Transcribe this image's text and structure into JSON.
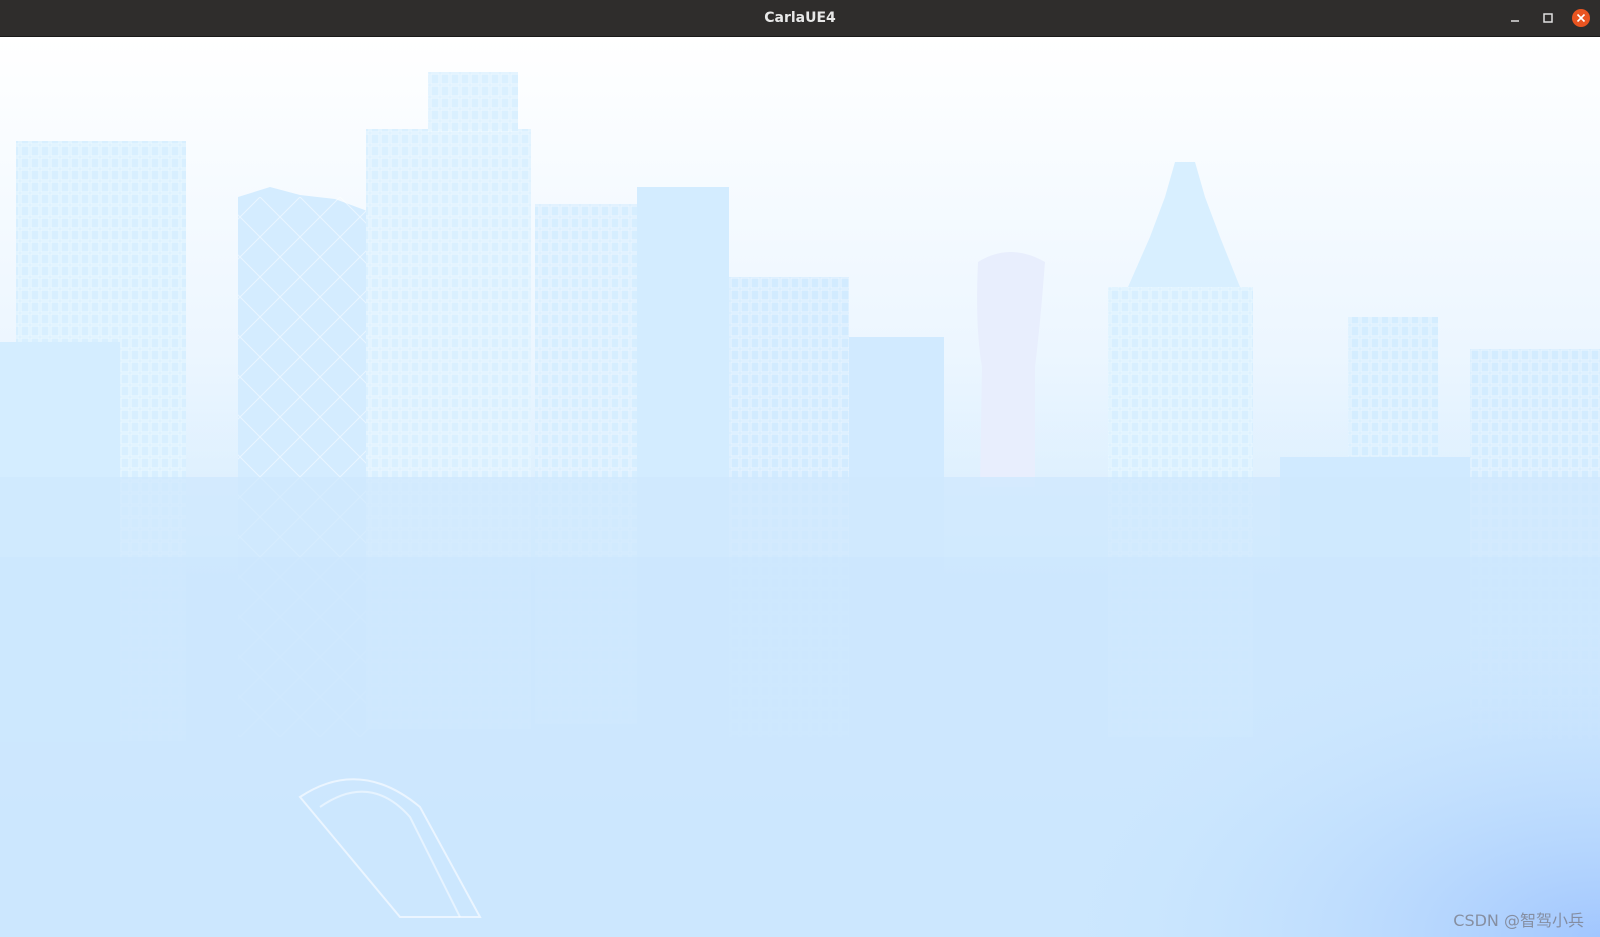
{
  "window": {
    "title": "CarlaUE4",
    "controls": {
      "minimize_icon": "minimize-icon",
      "maximize_icon": "maximize-icon",
      "close_icon": "close-icon"
    },
    "close_color": "#e95420"
  },
  "viewport": {
    "scene_description_icon": "city-skyline-scene",
    "sky_color": "#ffffff",
    "haze_color": "#cfe9fd",
    "building_color": "#d6eeff"
  },
  "watermark": {
    "text": "CSDN @智驾小兵"
  }
}
